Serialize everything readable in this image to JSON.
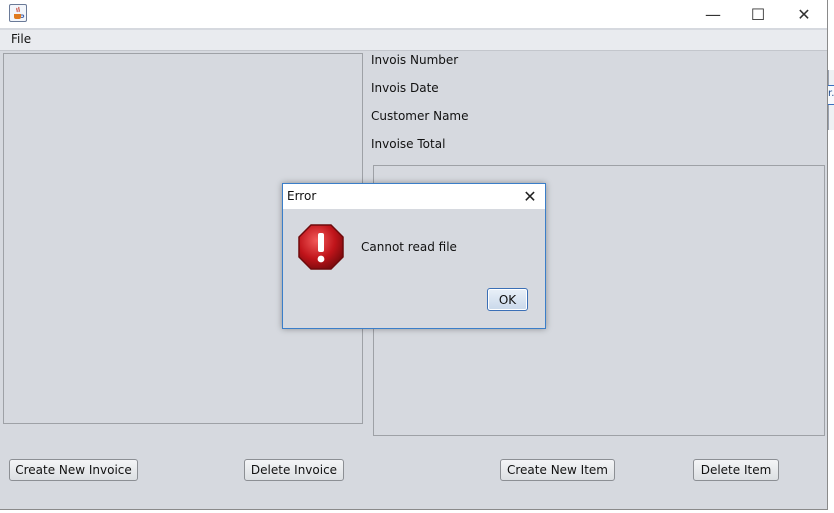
{
  "window": {
    "menu": [
      "File"
    ],
    "controls": {
      "minimize": "—",
      "maximize": "☐",
      "close": "✕"
    }
  },
  "invoice_fields": {
    "number_label": "Invois Number",
    "date_label": "Invois Date",
    "customer_label": "Customer Name",
    "total_label": "Invoise Total"
  },
  "buttons": {
    "create_invoice": "Create New Invoice",
    "delete_invoice": "Delete Invoice",
    "create_item": "Create New Item",
    "delete_item": "Delete Item"
  },
  "dialog": {
    "title": "Error",
    "close": "✕",
    "message": "Cannot read file",
    "ok_label": "OK",
    "icon": "error-stop-icon"
  },
  "colors": {
    "error_red": "#c0141a"
  }
}
